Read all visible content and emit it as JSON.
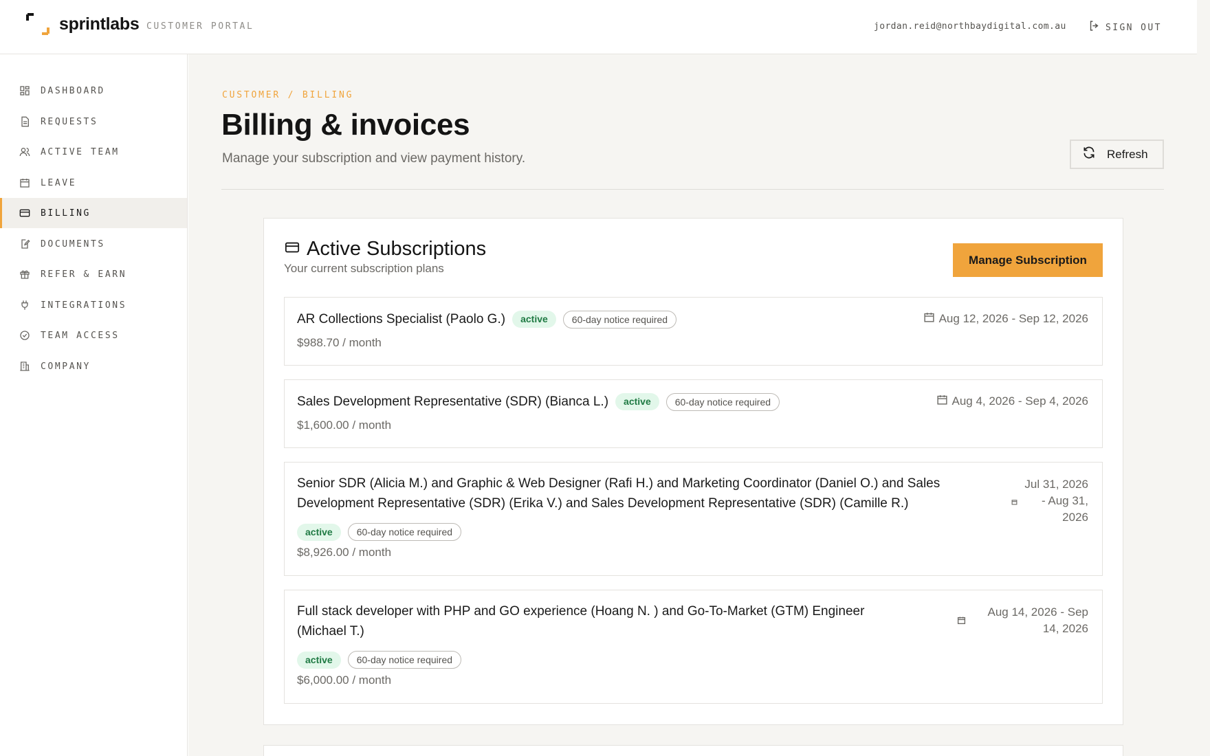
{
  "brand": {
    "name": "sprintlabs",
    "portal_label": "CUSTOMER PORTAL",
    "accent": "#f0a43c"
  },
  "header": {
    "user_email": "jordan.reid@northbaydigital.com.au",
    "sign_out_label": "SIGN OUT"
  },
  "sidebar": {
    "items": [
      {
        "label": "DASHBOARD",
        "icon": "dashboard-icon"
      },
      {
        "label": "REQUESTS",
        "icon": "document-icon"
      },
      {
        "label": "ACTIVE TEAM",
        "icon": "users-icon"
      },
      {
        "label": "LEAVE",
        "icon": "calendar-icon"
      },
      {
        "label": "BILLING",
        "icon": "credit-card-icon",
        "active": true
      },
      {
        "label": "DOCUMENTS",
        "icon": "file-edit-icon"
      },
      {
        "label": "REFER & EARN",
        "icon": "gift-icon"
      },
      {
        "label": "INTEGRATIONS",
        "icon": "plug-icon"
      },
      {
        "label": "TEAM ACCESS",
        "icon": "check-circle-icon"
      },
      {
        "label": "COMPANY",
        "icon": "building-icon"
      }
    ]
  },
  "page": {
    "breadcrumb": "CUSTOMER / BILLING",
    "title": "Billing & invoices",
    "subtitle": "Manage your subscription and view payment history.",
    "refresh_label": "Refresh"
  },
  "subscriptions_card": {
    "title": "Active Subscriptions",
    "subtitle": "Your current subscription plans",
    "manage_label": "Manage Subscription",
    "items": [
      {
        "name": "AR Collections Specialist (Paolo G.)",
        "status": "active",
        "notice": "60-day notice required",
        "price": "$988.70 / month",
        "dates": "Aug 12, 2026 - Sep 12, 2026"
      },
      {
        "name": "Sales Development Representative (SDR) (Bianca L.)",
        "status": "active",
        "notice": "60-day notice required",
        "price": "$1,600.00 / month",
        "dates": "Aug 4, 2026 - Sep 4, 2026"
      },
      {
        "name_line1": "Senior SDR (Alicia M.) and Graphic & Web Designer (Rafi H.) and Marketing Coordinator (Daniel O.) and Sales",
        "name_line2": "Development Representative (SDR) (Erika V.) and Sales Development Representative (SDR) (Camille R.)",
        "status": "active",
        "notice": "60-day notice required",
        "price": "$8,926.00 / month",
        "dates_line1": "Jul 31, 2026",
        "dates_line2": "- Aug 31,",
        "dates_line3": "2026"
      },
      {
        "name_line1": "Full stack developer with PHP and GO experience (Hoang N. ) and Go-To-Market (GTM) Engineer",
        "name_line2": "(Michael T.)",
        "status": "active",
        "notice": "60-day notice required",
        "price": "$6,000.00 / month",
        "dates_line1": "Aug 14, 2026 - Sep",
        "dates_line2": "14, 2026"
      }
    ]
  }
}
